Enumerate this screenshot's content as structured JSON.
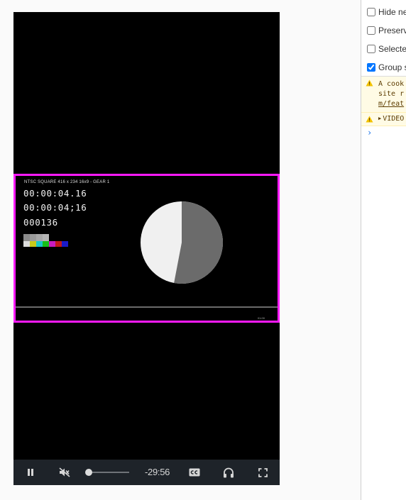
{
  "video": {
    "slate_title": "NTSC SQUARE  416 x 234  16x9  -  GEAR 1",
    "timecodes": [
      "00:00:04.16",
      "00:00:04;16",
      "000136"
    ],
    "frame_tag": "01:00",
    "border_color": "#ff1aff",
    "gray_swatches": [
      "#8a8a8a",
      "#9a9a9a",
      "#a9a9a9",
      "#b5b5b5"
    ],
    "color_swatches": [
      "#dcdcdc",
      "#c8c81a",
      "#19c8c8",
      "#17c018",
      "#c81cc0",
      "#c0181a",
      "#1a1ac8"
    ],
    "pie": {
      "progress_fraction": 0.53,
      "remaining_color": "#f0f0f0",
      "elapsed_color": "#6b6b6b"
    }
  },
  "controls": {
    "pause_icon": "pause-icon",
    "mute_icon": "muted-speaker-icon",
    "seek_progress": 0.0,
    "time_remaining": "-29:56",
    "cc_icon": "closed-captions-icon",
    "audio_icon": "headphones-icon",
    "fullscreen_icon": "fullscreen-icon"
  },
  "devtools": {
    "options": [
      {
        "label": "Hide ne",
        "checked": false
      },
      {
        "label": "Preserv",
        "checked": false
      },
      {
        "label": "Selecte",
        "checked": false
      },
      {
        "label": "Group s",
        "checked": true
      }
    ],
    "warning": {
      "lines": [
        "A cook",
        "site r"
      ],
      "link": "m/feat"
    },
    "video_entry": "VIDEO",
    "prompt": "›"
  }
}
